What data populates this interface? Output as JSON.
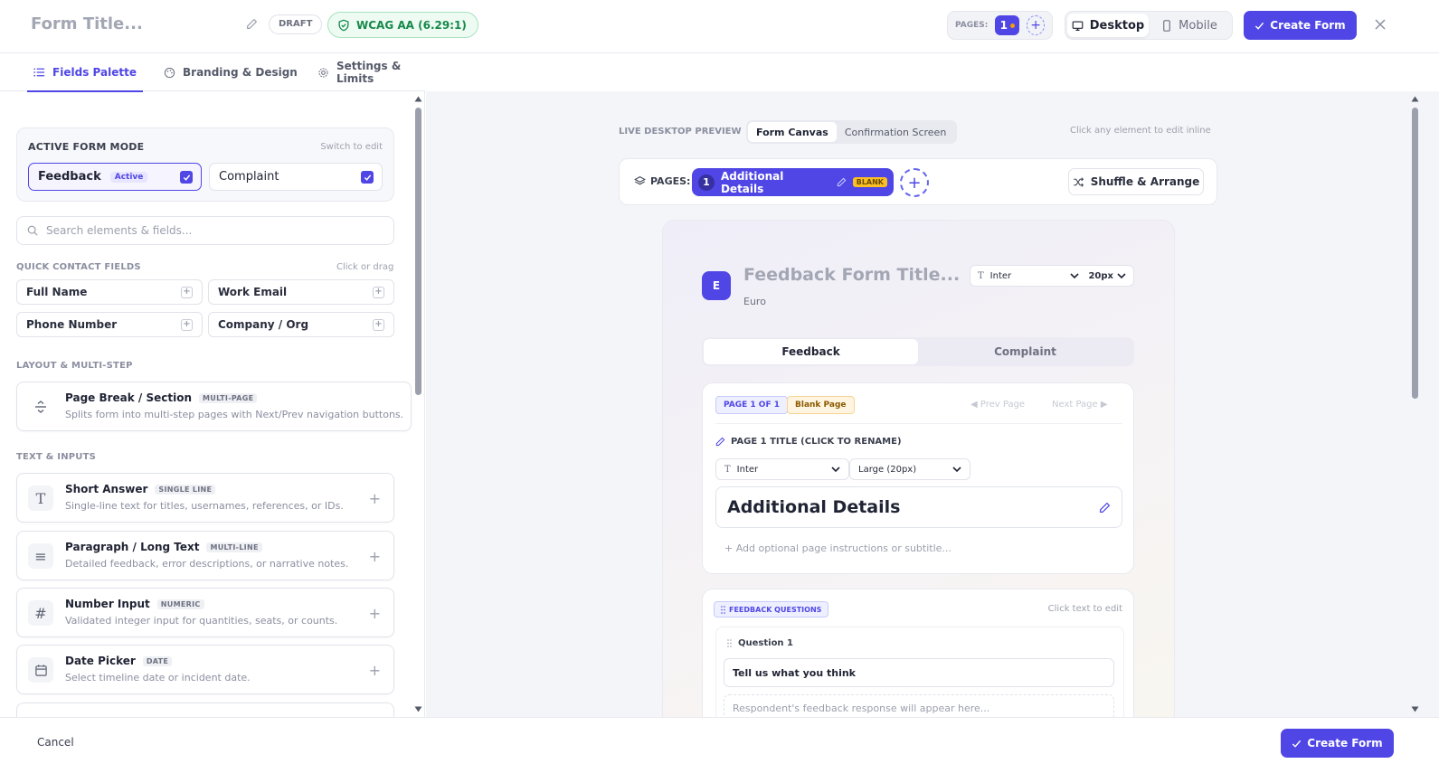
{
  "header": {
    "form_title": "Form Title...",
    "draft_label": "DRAFT",
    "wcag_label": "WCAG AA (6.29:1)",
    "pages_label": "PAGES:",
    "pages_count": "1",
    "device_desktop": "Desktop",
    "device_mobile": "Mobile",
    "create_label": "Create Form"
  },
  "tabs": [
    {
      "label": "Fields Palette"
    },
    {
      "label": "Branding & Design"
    },
    {
      "label": "Settings & Limits"
    }
  ],
  "mode": {
    "title": "ACTIVE FORM MODE",
    "hint": "Switch to edit",
    "options": [
      {
        "label": "Feedback",
        "badge": "Active"
      },
      {
        "label": "Complaint"
      }
    ]
  },
  "search": {
    "placeholder": "Search elements & fields..."
  },
  "quick": {
    "title": "QUICK CONTACT FIELDS",
    "hint": "Click or drag",
    "fields": [
      "Full Name",
      "Work Email",
      "Phone Number",
      "Company / Org"
    ]
  },
  "layout_section": {
    "title": "LAYOUT & MULTI-STEP",
    "item": {
      "title": "Page Break / Section",
      "tag": "MULTI-PAGE",
      "desc": "Splits form into multi-step pages with Next/Prev navigation buttons."
    }
  },
  "text_inputs": {
    "title": "TEXT & INPUTS",
    "items": [
      {
        "title": "Short Answer",
        "tag": "SINGLE LINE",
        "desc": "Single-line text for titles, usernames, references, or IDs.",
        "icon": "T"
      },
      {
        "title": "Paragraph / Long Text",
        "tag": "MULTI-LINE",
        "desc": "Detailed feedback, error descriptions, or narrative notes.",
        "icon": "≡"
      },
      {
        "title": "Number Input",
        "tag": "NUMERIC",
        "desc": "Validated integer input for quantities, seats, or counts.",
        "icon": "#"
      },
      {
        "title": "Date Picker",
        "tag": "DATE",
        "desc": "Select timeline date or incident date.",
        "icon": ""
      }
    ]
  },
  "footer": {
    "cancel_label": "Cancel",
    "create_label": "Create Form"
  },
  "preview": {
    "label": "LIVE DESKTOP PREVIEW",
    "seg_canvas": "Form Canvas",
    "seg_confirm": "Confirmation Screen",
    "hint": "Click any element to edit inline",
    "pages_label": "PAGES:",
    "page_num": "1",
    "page_name": "Additional Details",
    "page_tag": "BLANK",
    "shuffle_label": "Shuffle & Arrange"
  },
  "canvas": {
    "logo_letter": "E",
    "title": "Feedback Form Title...",
    "subtitle": "Euro",
    "font": "Inter",
    "size": "20px",
    "mode_tabs": [
      "Feedback",
      "Complaint"
    ],
    "page_badge": "PAGE 1 OF 1",
    "blank_badge": "Blank Page",
    "prev": "◀ Prev Page",
    "next": "Next Page ▶",
    "page_title_label": "PAGE 1 TITLE (CLICK TO RENAME)",
    "title_font": "Inter",
    "title_size": "Large (20px)",
    "page_title": "Additional Details",
    "add_instr": "+ Add optional page instructions or subtitle...",
    "fq_label": "FEEDBACK QUESTIONS",
    "fq_hint": "Click text to edit",
    "q_label": "Question 1",
    "q_text": "Tell us what you think",
    "q_placeholder": "Respondent's feedback response will appear here..."
  },
  "colors": {
    "accent": "#4f46e5",
    "success": "#16894a",
    "warning": "#fbbf24"
  }
}
